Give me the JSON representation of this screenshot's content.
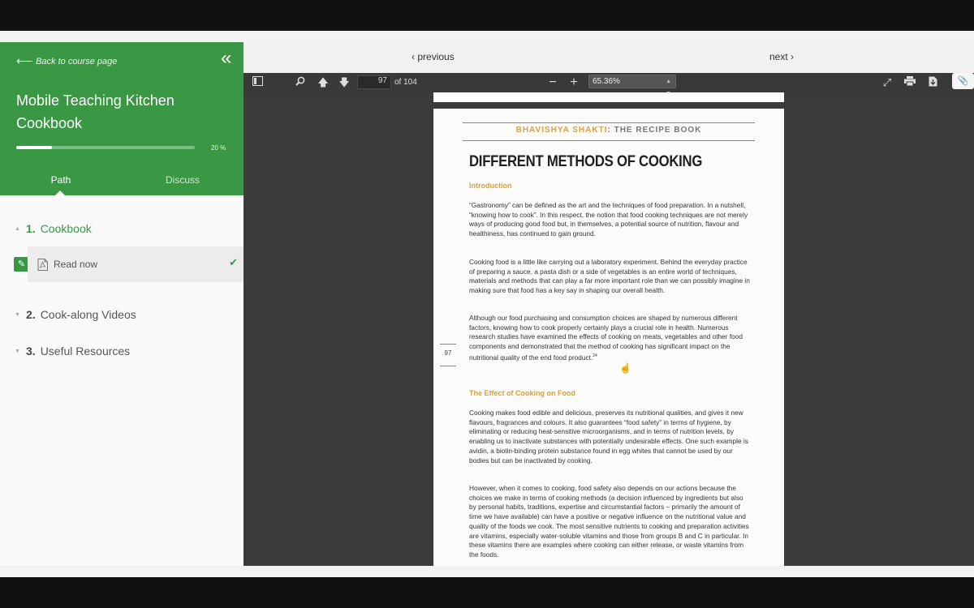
{
  "sidebar": {
    "back_label": "Back to course page",
    "course_title": "Mobile Teaching Kitchen Cookbook",
    "progress": {
      "value": 0.2,
      "label": "20 %"
    },
    "tabs": [
      {
        "label": "Path"
      },
      {
        "label": "Discuss"
      }
    ],
    "sections": [
      {
        "num": "1.",
        "label": "Cookbook"
      },
      {
        "num": "2.",
        "label": "Cook-along Videos"
      },
      {
        "num": "3.",
        "label": "Useful Resources"
      }
    ],
    "active_item": {
      "label": "Read now"
    },
    "accent_color": "#3a9844"
  },
  "nav": {
    "previous": "previous",
    "next": "next"
  },
  "toolbar": {
    "page_current": "97",
    "page_total": "of 104",
    "zoom": "65.36%"
  },
  "document": {
    "header_highlight": "BHAVISHYA SHAKTI",
    "header_rest": ": THE RECIPE BOOK",
    "title": "DIFFERENT METHODS OF COOKING",
    "intro_heading": "Introduction",
    "paragraphs": [
      "“Gastronomy” can be defined as the art and the techniques of food preparation. In a nutshell, “knowing how to cook”. In this respect, the notion that food cooking techniques are not merely ways of producing good food but, in themselves, a potential source of nutrition, flavour and healthiness, has continued to gain ground.",
      "Cooking food is a little like carrying out a laboratory experiment. Behind the everyday practice of preparing a sauce, a pasta dish or a side of vegetables is an entire world of techniques, materials and methods that can play a far more important role than we can possibly imagine in making sure that food has a key say in shaping our overall health.",
      "Although our food purchasing and consumption choices are shaped by numerous different factors, knowing how to cook properly certainly plays a crucial role in health. Numerous research studies have examined the effects of cooking on meats, vegetables and other food components and demonstrated that the method of cooking has significant impact on the nutritional quality of the end food product.",
      "Cooking makes food edible and delicious, preserves its nutritional qualities, and gives it new flavours, fragrances and colours. It also guarantees “food safety” in terms of hygiene, by eliminating or reducing heat-sensitive microorganisms, and in terms of nutrition levels, by enabling us to inactivate substances with potentially undesirable effects. One such example is avidin, a biotin-binding protein substance found in egg whites that cannot be used by our bodies but can be inactivated by cooking.",
      "However, when it comes to cooking, food safety also depends on our actions because the choices we make in terms of cooking methods (a decision influenced by ingredients but also by personal habits, traditions, expertise and circumstantial factors – primarily the amount of time we have available) can have a positive or negative influence on the nutritional value and quality of the foods we cook. The most sensitive nutrients to cooking and preparation activities are vitamins, especially water-soluble vitamins and those from groups B and C in particular. In these vitamins there are examples where cooking can either release, or waste vitamins from the foods."
    ],
    "footnote_ref": "24",
    "section_heading": "The Effect of Cooking on Food",
    "page_number": "97"
  }
}
